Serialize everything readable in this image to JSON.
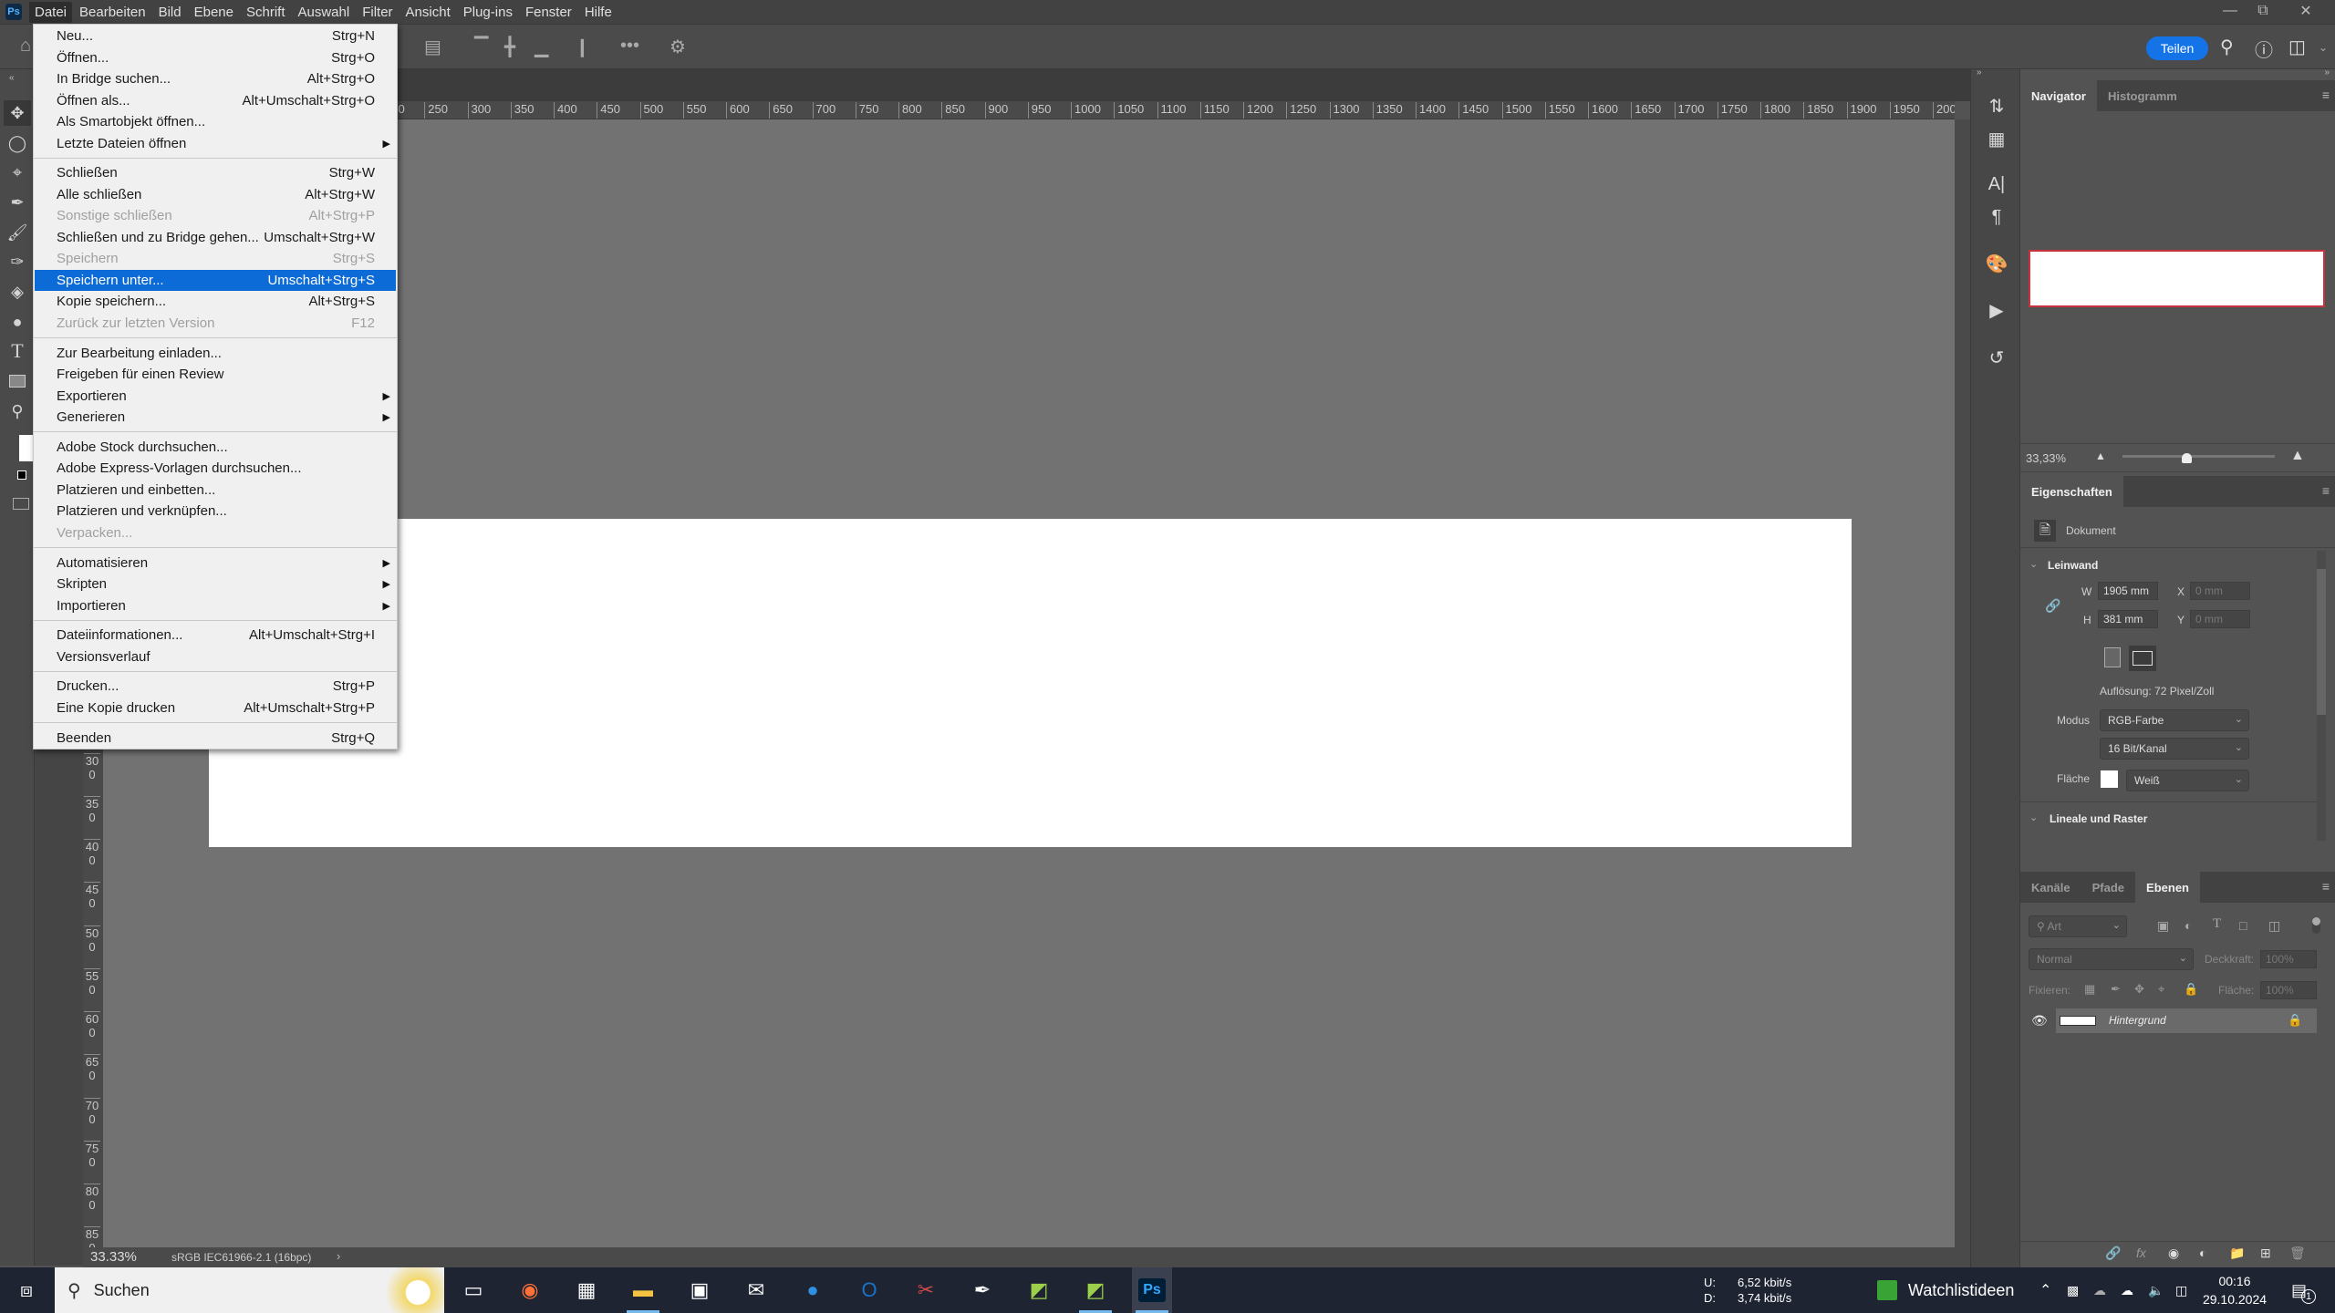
{
  "app": {
    "logo": "Ps"
  },
  "menubar": {
    "items": [
      "Datei",
      "Bearbeiten",
      "Bild",
      "Ebene",
      "Schrift",
      "Auswahl",
      "Filter",
      "Ansicht",
      "Plug-ins",
      "Fenster",
      "Hilfe"
    ],
    "active": "Datei"
  },
  "window_controls": {
    "icons": [
      "minimize-icon",
      "restore-icon",
      "close-icon"
    ]
  },
  "options_bar": {
    "share_label": "Teilen",
    "accent": "#1473e6"
  },
  "file_menu": {
    "groups": [
      [
        {
          "label": "Neu...",
          "shortcut": "Strg+N"
        },
        {
          "label": "Öffnen...",
          "shortcut": "Strg+O"
        },
        {
          "label": "In Bridge suchen...",
          "shortcut": "Alt+Strg+O"
        },
        {
          "label": "Öffnen als...",
          "shortcut": "Alt+Umschalt+Strg+O"
        },
        {
          "label": "Als Smartobjekt öffnen...",
          "shortcut": ""
        },
        {
          "label": "Letzte Dateien öffnen",
          "shortcut": "",
          "submenu": true
        }
      ],
      [
        {
          "label": "Schließen",
          "shortcut": "Strg+W"
        },
        {
          "label": "Alle schließen",
          "shortcut": "Alt+Strg+W"
        },
        {
          "label": "Sonstige schließen",
          "shortcut": "Alt+Strg+P",
          "disabled": true
        },
        {
          "label": "Schließen und zu Bridge gehen...",
          "shortcut": "Umschalt+Strg+W"
        },
        {
          "label": "Speichern",
          "shortcut": "Strg+S",
          "disabled": true
        },
        {
          "label": "Speichern unter...",
          "shortcut": "Umschalt+Strg+S",
          "highlighted": true
        },
        {
          "label": "Kopie speichern...",
          "shortcut": "Alt+Strg+S"
        },
        {
          "label": "Zurück zur letzten Version",
          "shortcut": "F12",
          "disabled": true
        }
      ],
      [
        {
          "label": "Zur Bearbeitung einladen...",
          "shortcut": ""
        },
        {
          "label": "Freigeben für einen Review",
          "shortcut": ""
        },
        {
          "label": "Exportieren",
          "shortcut": "",
          "submenu": true
        },
        {
          "label": "Generieren",
          "shortcut": "",
          "submenu": true
        }
      ],
      [
        {
          "label": "Adobe Stock durchsuchen...",
          "shortcut": ""
        },
        {
          "label": "Adobe Express-Vorlagen durchsuchen...",
          "shortcut": ""
        },
        {
          "label": "Platzieren und einbetten...",
          "shortcut": ""
        },
        {
          "label": "Platzieren und verknüpfen...",
          "shortcut": ""
        },
        {
          "label": "Verpacken...",
          "shortcut": "",
          "disabled": true
        }
      ],
      [
        {
          "label": "Automatisieren",
          "shortcut": "",
          "submenu": true
        },
        {
          "label": "Skripten",
          "shortcut": "",
          "submenu": true
        },
        {
          "label": "Importieren",
          "shortcut": "",
          "submenu": true
        }
      ],
      [
        {
          "label": "Dateiinformationen...",
          "shortcut": "Alt+Umschalt+Strg+I"
        },
        {
          "label": "Versionsverlauf",
          "shortcut": ""
        }
      ],
      [
        {
          "label": "Drucken...",
          "shortcut": "Strg+P"
        },
        {
          "label": "Eine Kopie drucken",
          "shortcut": "Alt+Umschalt+Strg+P"
        }
      ],
      [
        {
          "label": "Beenden",
          "shortcut": "Strg+Q"
        }
      ]
    ],
    "highlight_color": "#0c6bd6"
  },
  "rulers": {
    "unit": "mm",
    "horizontal_range": [
      0,
      2000
    ],
    "vertical_range": [
      0,
      850
    ],
    "step": 50
  },
  "navigator": {
    "tabs": [
      "Navigator",
      "Histogramm"
    ],
    "active": "Navigator",
    "zoom": "33,33%",
    "zoom_slider_fraction": 0.42,
    "view_box_color": "#c8323c"
  },
  "properties": {
    "title": "Eigenschaften",
    "type": "Dokument",
    "section_canvas": "Leinwand",
    "w_label": "W",
    "w_value": "1905 mm",
    "h_label": "H",
    "h_value": "381 mm",
    "x_label": "X",
    "x_value": "0 mm",
    "y_label": "Y",
    "y_value": "0 mm",
    "resolution": "Auflösung: 72 Pixel/Zoll",
    "mode_label": "Modus",
    "mode_value": "RGB-Farbe",
    "depth_value": "16 Bit/Kanal",
    "fill_label": "Fläche",
    "fill_value": "Weiß",
    "section_rulers": "Lineale und Raster"
  },
  "layers_panel": {
    "tabs": [
      "Kanäle",
      "Pfade",
      "Ebenen"
    ],
    "active": "Ebenen",
    "filter_placeholder": "Art",
    "blend_mode": "Normal",
    "opacity_label": "Deckkraft:",
    "opacity_value": "100%",
    "lock_label": "Fixieren:",
    "fill_label": "Fläche:",
    "fill_value": "100%",
    "layers": [
      {
        "name": "Hintergrund",
        "visible": true,
        "locked": true
      }
    ]
  },
  "status_bar": {
    "zoom": "33.33%",
    "profile": "sRGB IEC61966-2.1 (16bpc)"
  },
  "taskbar": {
    "search_placeholder": "Suchen",
    "apps": [
      "task-view",
      "firefox",
      "calendar",
      "file-explorer",
      "microsoft-store",
      "mail",
      "thunderbird",
      "outlook",
      "snipping-tool",
      "color-picker",
      "stock-app",
      "stock-app-2",
      "photoshop"
    ],
    "network_up_label": "U:",
    "network_up": "6,52 kbit/s",
    "network_down_label": "D:",
    "network_down": "3,74 kbit/s",
    "widget": "Watchlistideen",
    "time": "00:16",
    "date": "29.10.2024",
    "notifications": "1"
  }
}
